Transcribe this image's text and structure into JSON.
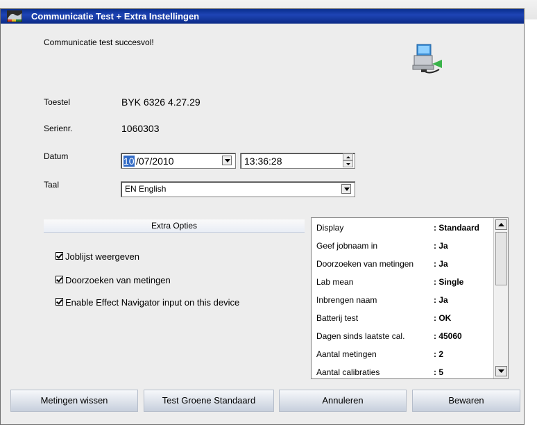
{
  "window": {
    "title": "Communicatie Test + Extra Instellingen"
  },
  "status": {
    "message": "Communicatie test succesvol!"
  },
  "device": {
    "toestel_label": "Toestel",
    "toestel_value": "BYK 6326 4.27.29",
    "serienr_label": "Serienr.",
    "serienr_value": "1060303"
  },
  "datum": {
    "label": "Datum",
    "day_selected": "10",
    "date_rest": "/07/2010",
    "time": "13:36:28"
  },
  "taal": {
    "label": "Taal",
    "value": "EN English"
  },
  "extra_opties": {
    "header": "Extra Opties",
    "checkboxes": [
      {
        "label": "Joblijst weergeven",
        "checked": true
      },
      {
        "label": "Doorzoeken van metingen",
        "checked": true
      },
      {
        "label": "Enable Effect Navigator input on this device",
        "checked": true
      }
    ]
  },
  "info_list": [
    {
      "key": "Display",
      "value": ": Standaard"
    },
    {
      "key": "Geef jobnaam in",
      "value": ": Ja"
    },
    {
      "key": "Doorzoeken van metingen",
      "value": ": Ja"
    },
    {
      "key": "Lab mean",
      "value": ": Single"
    },
    {
      "key": "Inbrengen naam",
      "value": ": Ja"
    },
    {
      "key": "Batterij test",
      "value": ": OK"
    },
    {
      "key": "Dagen sinds laatste cal.",
      "value": ": 45060"
    },
    {
      "key": "Aantal metingen",
      "value": ": 2"
    },
    {
      "key": "Aantal calibraties",
      "value": ": 5"
    }
  ],
  "buttons": {
    "metingen_wissen": "Metingen wissen",
    "test_groene": "Test Groene Standaard",
    "annuleren": "Annuleren",
    "bewaren": "Bewaren"
  },
  "colors": {
    "title_bar": "#1e44b5",
    "background": "#ededed",
    "selection": "#316ac5"
  },
  "icons": {
    "window_icon": "window-app-icon",
    "network_icon": "computer-network-icon"
  }
}
